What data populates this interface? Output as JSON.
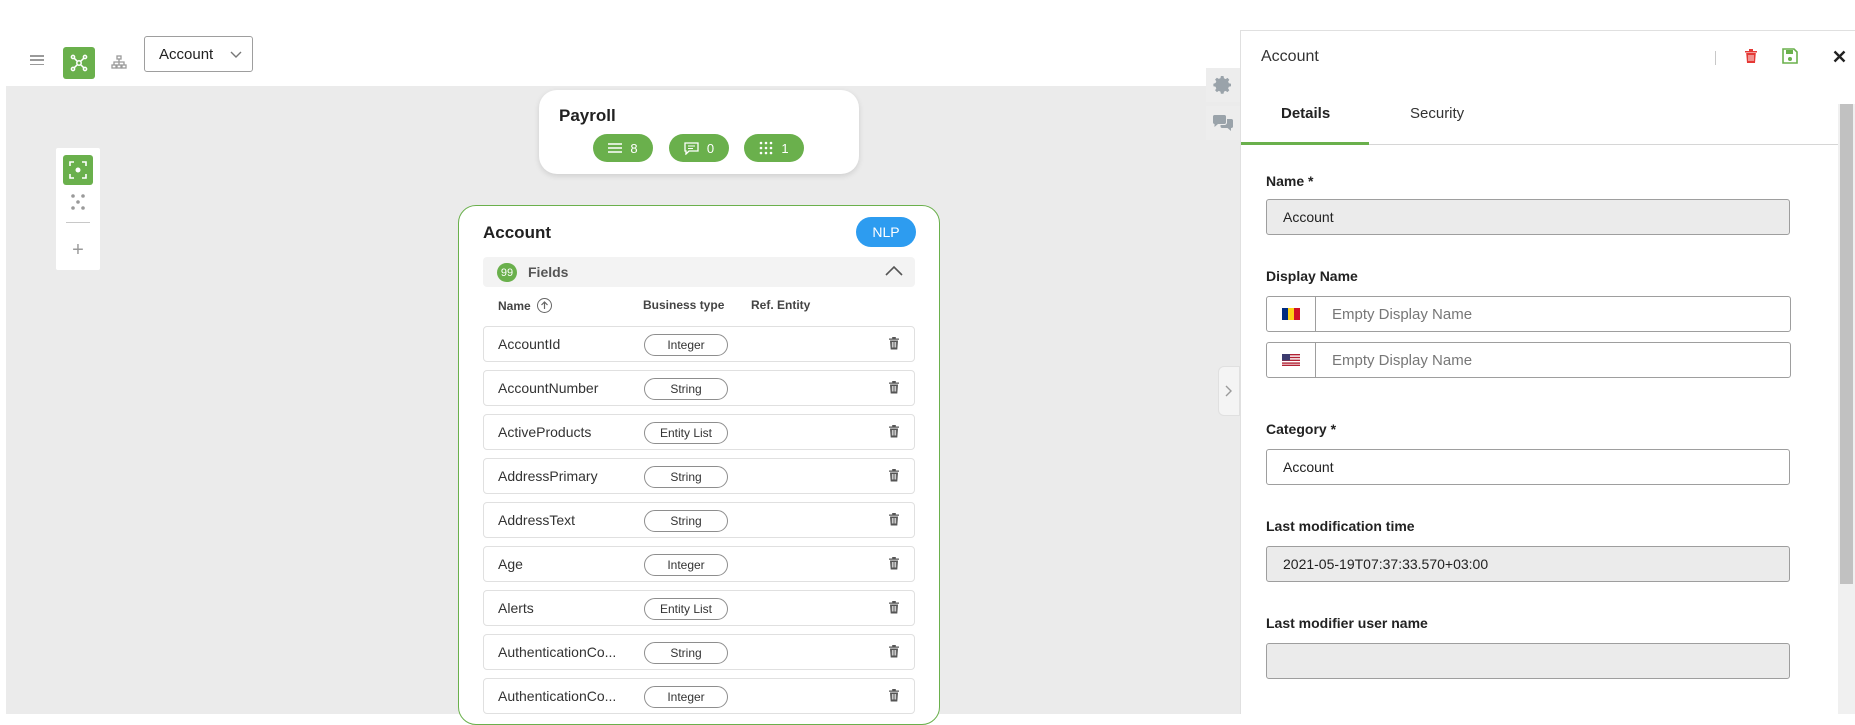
{
  "toolbar": {
    "menu_icon": "hamburger-icon",
    "entity_model_icon": "entity-graph-icon",
    "hierarchy_icon": "hierarchy-icon",
    "entity_select": {
      "value": "Account"
    },
    "accent_color": "#6ab04c"
  },
  "left_tools": {
    "focus_icon": "focus-icon",
    "layout_icon": "dots-layout-icon",
    "add_icon": "plus-icon"
  },
  "payroll_card": {
    "title": "Payroll",
    "pills": [
      {
        "icon": "list-icon",
        "count": "8"
      },
      {
        "icon": "comment-icon",
        "count": "0"
      },
      {
        "icon": "grid-dots-icon",
        "count": "1"
      }
    ]
  },
  "entity_card": {
    "title": "Account",
    "nlp_label": "NLP",
    "nlp_color": "#2d9cf0",
    "fields_count": "99",
    "fields_label": "Fields",
    "columns": {
      "name": "Name",
      "business_type": "Business type",
      "ref_entity": "Ref. Entity"
    },
    "fields": [
      {
        "name": "AccountId",
        "type": "Integer"
      },
      {
        "name": "AccountNumber",
        "type": "String"
      },
      {
        "name": "ActiveProducts",
        "type": "Entity List"
      },
      {
        "name": "AddressPrimary",
        "type": "String"
      },
      {
        "name": "AddressText",
        "type": "String"
      },
      {
        "name": "Age",
        "type": "Integer"
      },
      {
        "name": "Alerts",
        "type": "Entity List"
      },
      {
        "name": "AuthenticationCo...",
        "type": "String"
      },
      {
        "name": "AuthenticationCo...",
        "type": "Integer"
      }
    ]
  },
  "panel": {
    "title": "Account",
    "delete_color": "#e53935",
    "tabs": [
      {
        "label": "Details"
      },
      {
        "label": "Security"
      }
    ],
    "name_label": "Name *",
    "name_value": "Account",
    "display_name_label": "Display Name",
    "display_names": [
      {
        "flag": "ro-flag-icon",
        "placeholder": "Empty Display Name"
      },
      {
        "flag": "us-flag-icon",
        "placeholder": "Empty Display Name"
      }
    ],
    "category_label": "Category *",
    "category_value": "Account",
    "last_mod_time_label": "Last modification time",
    "last_mod_time_value": "2021-05-19T07:37:33.570+03:00",
    "last_modifier_label": "Last modifier user name",
    "last_modifier_value": ""
  }
}
